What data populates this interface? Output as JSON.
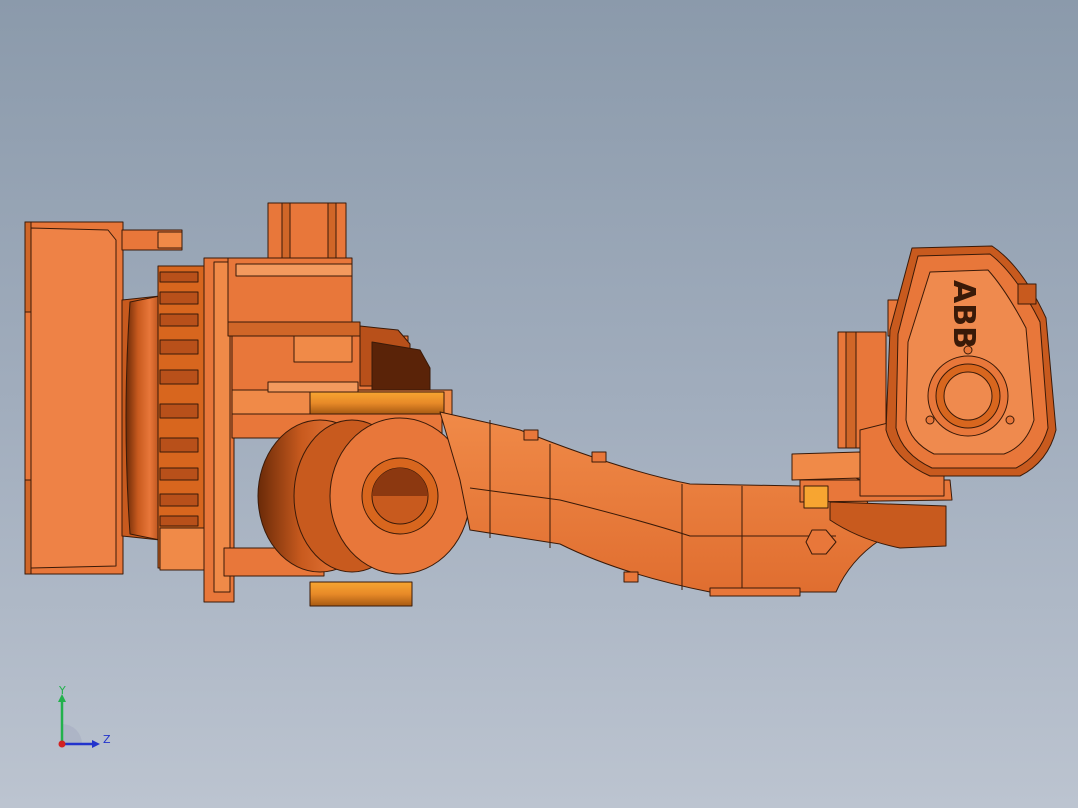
{
  "model": {
    "logo_text": "ABB",
    "body_color": "#e8773a",
    "light_color": "#f39a5e",
    "dark_color": "#b8501a",
    "edge_color": "#3a1a08",
    "accent_color": "#f7a531"
  },
  "triad": {
    "y_label": "Y",
    "z_label": "Z",
    "y_color": "#22b14c",
    "z_color": "#2233cc",
    "x_color": "#d22222"
  },
  "background": {
    "top": "#8b9aab",
    "bottom": "#bcc4d0"
  }
}
